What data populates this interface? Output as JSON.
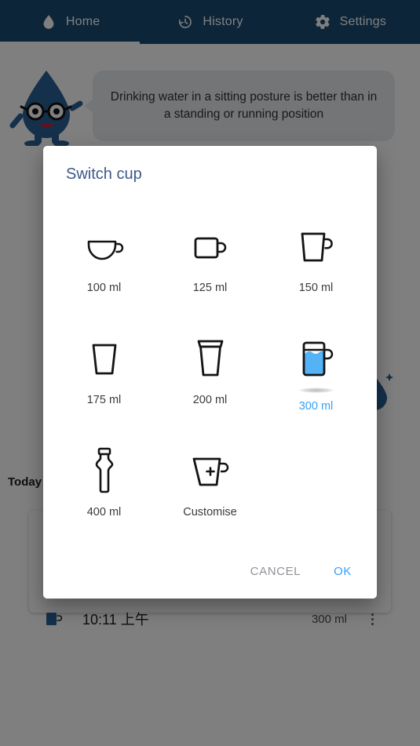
{
  "colors": {
    "appbar": "#1b4a73",
    "accent": "#33a0f7",
    "dialog_title": "#3b5a8a",
    "water_blue": "#54b3f7",
    "mascot_blue": "#2a6096",
    "cancel_gray": "#8f9297"
  },
  "tabs": [
    {
      "label": "Home",
      "icon": "water-drop-icon",
      "selected": true
    },
    {
      "label": "History",
      "icon": "history-clock-icon",
      "selected": false
    },
    {
      "label": "Settings",
      "icon": "gear-icon",
      "selected": false
    }
  ],
  "tip": {
    "text": "Drinking water in a sitting posture is better than in a standing or running position",
    "mascot_icon": "water-drop-mascot-icon"
  },
  "history": {
    "section_label": "Today",
    "entry": {
      "icon": "mug-icon",
      "time": "10:11 上午",
      "amount": "300 ml",
      "menu_icon": "overflow-menu-icon"
    }
  },
  "dialog": {
    "title": "Switch cup",
    "cups": [
      {
        "label": "100 ml",
        "icon": "teacup-icon",
        "selected": false
      },
      {
        "label": "125 ml",
        "icon": "small-mug-icon",
        "selected": false
      },
      {
        "label": "150 ml",
        "icon": "tall-mug-icon",
        "selected": false
      },
      {
        "label": "175 ml",
        "icon": "glass-icon",
        "selected": false
      },
      {
        "label": "200 ml",
        "icon": "takeaway-cup-icon",
        "selected": false
      },
      {
        "label": "300 ml",
        "icon": "filled-mug-icon",
        "selected": true
      },
      {
        "label": "400 ml",
        "icon": "bottle-icon",
        "selected": false
      },
      {
        "label": "Customise",
        "icon": "measuring-jug-plus-icon",
        "selected": false
      }
    ],
    "cancel_label": "CANCEL",
    "ok_label": "OK"
  }
}
